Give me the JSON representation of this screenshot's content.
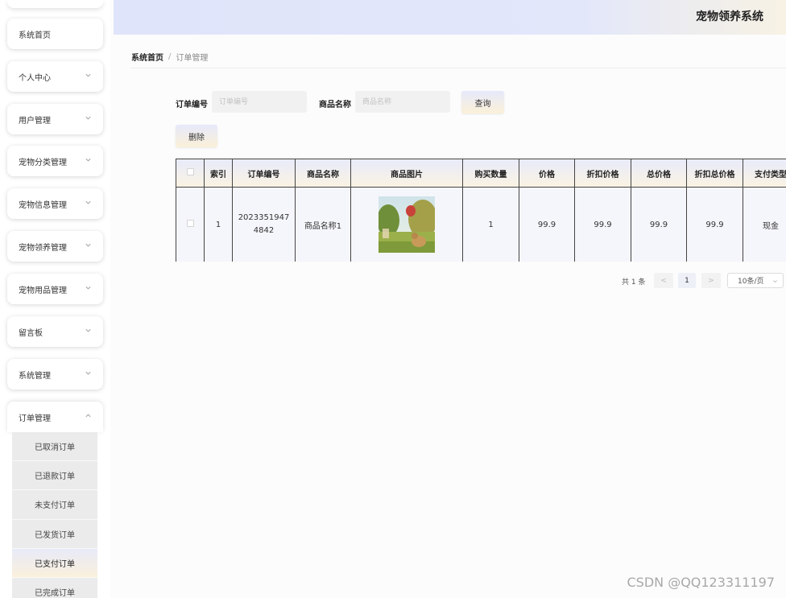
{
  "header": {
    "title": "宠物领养系统"
  },
  "sidebar": {
    "items": [
      {
        "label": "系统首页",
        "has_arrow": false
      },
      {
        "label": "个人中心",
        "has_arrow": true
      },
      {
        "label": "用户管理",
        "has_arrow": true
      },
      {
        "label": "宠物分类管理",
        "has_arrow": true
      },
      {
        "label": "宠物信息管理",
        "has_arrow": true
      },
      {
        "label": "宠物领养管理",
        "has_arrow": true
      },
      {
        "label": "宠物用品管理",
        "has_arrow": true
      },
      {
        "label": "留言板",
        "has_arrow": true
      },
      {
        "label": "系统管理",
        "has_arrow": true
      },
      {
        "label": "订单管理",
        "has_arrow": true,
        "expanded": true
      }
    ],
    "submenu": [
      {
        "label": "已取消订单"
      },
      {
        "label": "已退款订单"
      },
      {
        "label": "未支付订单"
      },
      {
        "label": "已发货订单"
      },
      {
        "label": "已支付订单",
        "active": true
      },
      {
        "label": "已完成订单"
      }
    ]
  },
  "breadcrumb": {
    "home": "系统首页",
    "separator": "/",
    "current": "订单管理"
  },
  "search": {
    "order_no_label": "订单编号",
    "order_no_placeholder": "订单编号",
    "order_no_value": "",
    "product_name_label": "商品名称",
    "product_name_placeholder": "商品名称",
    "product_name_value": "",
    "query_button": "查询"
  },
  "actions": {
    "delete_button": "删除"
  },
  "table": {
    "columns": [
      "",
      "索引",
      "订单编号",
      "商品名称",
      "商品图片",
      "购买数量",
      "价格",
      "折扣价格",
      "总价格",
      "折扣总价格",
      "支付类型"
    ],
    "rows": [
      {
        "index": "1",
        "order_no": "20233519474842",
        "product_name": "商品名称1",
        "image": "dog-in-park-photo",
        "quantity": "1",
        "price": "99.9",
        "discount_price": "99.9",
        "total_price": "99.9",
        "discount_total": "99.9",
        "pay_type": "现金"
      }
    ]
  },
  "pagination": {
    "total_text": "共 1 条",
    "prev": "<",
    "current_page": "1",
    "next": ">",
    "page_size": "10条/页"
  },
  "watermark": "CSDN @QQ123311197",
  "colors": {
    "header_gradient_start": "#dfe4fa",
    "header_gradient_end": "#f7f2e4",
    "table_border": "#444444",
    "active_submenu": "#e7eaf8"
  }
}
